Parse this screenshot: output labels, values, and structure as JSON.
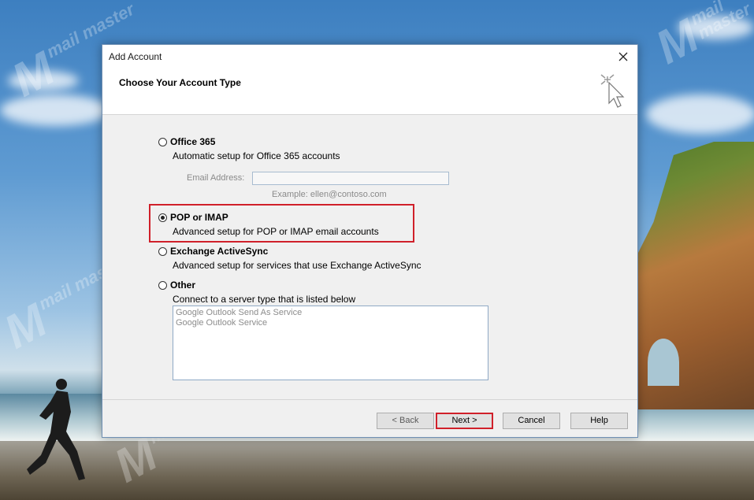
{
  "window": {
    "title": "Add Account",
    "header_title": "Choose Your Account Type"
  },
  "options": [
    {
      "label": "Office 365",
      "description": "Automatic setup for Office 365 accounts",
      "selected": false
    },
    {
      "label": "POP or IMAP",
      "description": "Advanced setup for POP or IMAP email accounts",
      "selected": true
    },
    {
      "label": "Exchange ActiveSync",
      "description": "Advanced setup for services that use Exchange ActiveSync",
      "selected": false
    },
    {
      "label": "Other",
      "description": "Connect to a server type that is listed below",
      "selected": false
    }
  ],
  "email": {
    "label": "Email Address:",
    "value": "",
    "example": "Example: ellen@contoso.com"
  },
  "server_types": [
    "Google Outlook Send As Service",
    "Google Outlook Service"
  ],
  "buttons": {
    "back": "< Back",
    "next": "Next >",
    "cancel": "Cancel",
    "help": "Help"
  },
  "watermark": "mail master",
  "colors": {
    "highlight": "#d0202a",
    "dialog_bg": "#f0f0f0"
  }
}
